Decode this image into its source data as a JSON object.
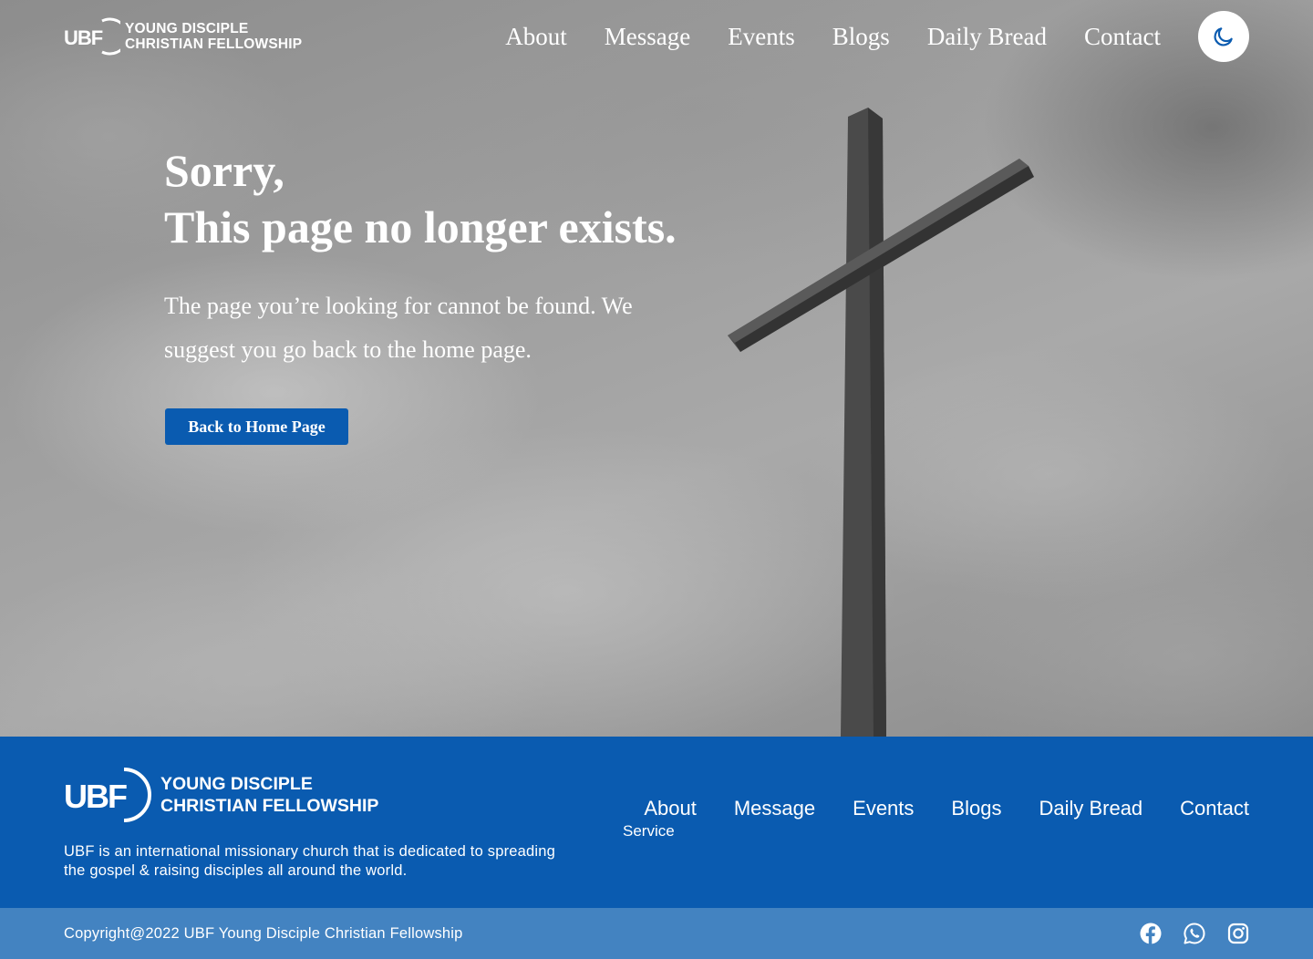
{
  "brand": {
    "line1": "YOUNG DISCIPLE",
    "line2": "CHRISTIAN FELLOWSHIP",
    "logo_text": "UBF"
  },
  "nav": {
    "items": [
      {
        "label": "About"
      },
      {
        "label": "Message"
      },
      {
        "label": "Events"
      },
      {
        "label": "Blogs"
      },
      {
        "label": "Daily Bread"
      },
      {
        "label": "Contact"
      }
    ],
    "theme_icon": "moon-icon"
  },
  "hero": {
    "title_line1": "Sorry,",
    "title_line2": "This page no longer exists.",
    "description": "The page you’re looking for cannot be found. We suggest you go back to the home page.",
    "button_label": "Back to Home Page"
  },
  "footer": {
    "brand_line1": "YOUNG DISCIPLE",
    "brand_line2": "CHRISTIAN FELLOWSHIP",
    "description": "UBF is an international missionary church that is dedicated to spreading the gospel & raising disciples all around the world.",
    "links": [
      {
        "label": "About"
      },
      {
        "label": "Message"
      },
      {
        "label": "Events"
      },
      {
        "label": "Blogs"
      },
      {
        "label": "Daily Bread"
      },
      {
        "label": "Contact"
      }
    ],
    "sub_link": "Service",
    "copyright": "Copyright@2022 UBF Young Disciple Christian Fellowship",
    "socials": [
      "facebook-icon",
      "whatsapp-icon",
      "instagram-icon"
    ]
  },
  "colors": {
    "primary": "#0a5bb0",
    "bottom_bar": "#4383c1",
    "white": "#ffffff"
  }
}
